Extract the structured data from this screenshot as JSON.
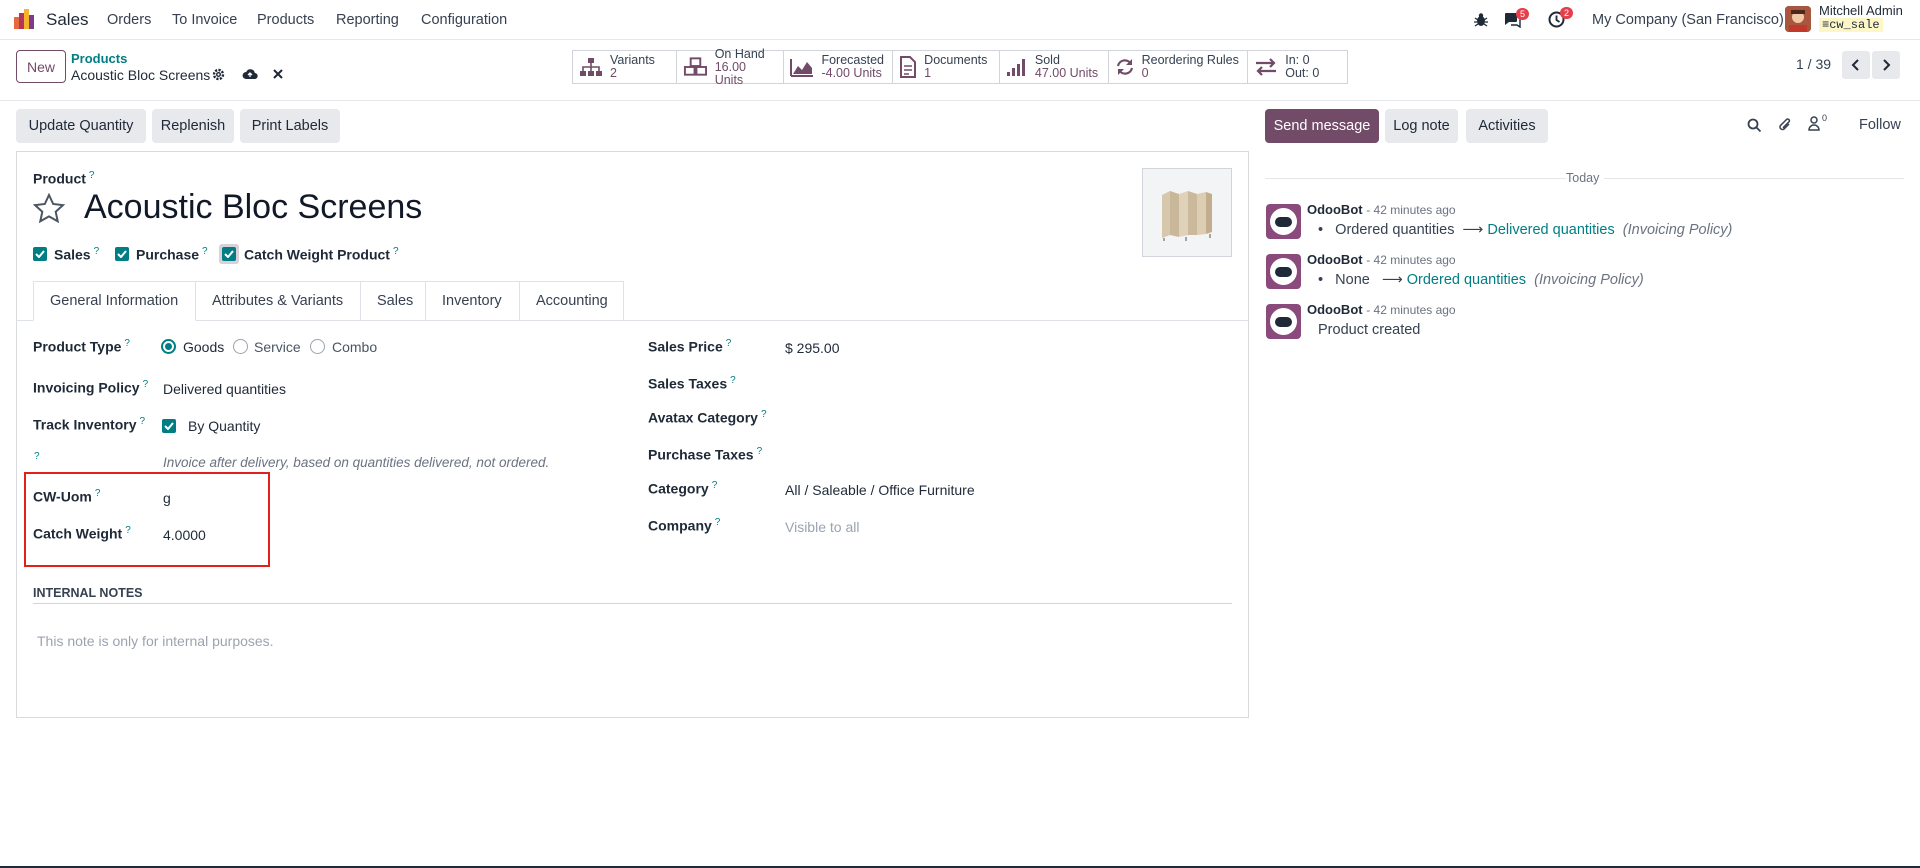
{
  "topnav": {
    "app_name": "Sales",
    "menu": [
      "Orders",
      "To Invoice",
      "Products",
      "Reporting",
      "Configuration"
    ],
    "messages_count": "5",
    "activities_count": "2",
    "company": "My Company (San Francisco)",
    "user_name": "Mitchell Admin",
    "db_name": "cw_sale"
  },
  "breadcrumb": {
    "parent": "Products",
    "current": "Acoustic Bloc Screens"
  },
  "buttons": {
    "new": "New",
    "update_quantity": "Update Quantity",
    "replenish": "Replenish",
    "print_labels": "Print Labels"
  },
  "smart_buttons": {
    "variants": {
      "label": "Variants",
      "value": "2"
    },
    "on_hand": {
      "label": "On Hand",
      "value": "16.00 Units"
    },
    "forecasted": {
      "label": "Forecasted",
      "value": "-4.00 Units"
    },
    "documents": {
      "label": "Documents",
      "value": "1"
    },
    "sold": {
      "label": "Sold",
      "value": "47.00 Units"
    },
    "reordering": {
      "label": "Reordering Rules",
      "value": "0"
    },
    "inout": {
      "in": "In: 0",
      "out": "Out: 0"
    }
  },
  "pager": "1 / 39",
  "form": {
    "product_label": "Product",
    "product_name": "Acoustic Bloc Screens",
    "check_sales": "Sales",
    "check_purchase": "Purchase",
    "check_catch_weight": "Catch Weight Product",
    "tabs": [
      "General Information",
      "Attributes & Variants",
      "Sales",
      "Inventory",
      "Accounting"
    ],
    "product_type_label": "Product Type",
    "product_type_options": [
      "Goods",
      "Service",
      "Combo"
    ],
    "product_type_selected": "Goods",
    "invoicing_policy_label": "Invoicing Policy",
    "invoicing_policy_value": "Delivered quantities",
    "track_inventory_label": "Track Inventory",
    "track_inventory_value": "By Quantity",
    "invoice_hint": "Invoice after delivery, based on quantities delivered, not ordered.",
    "cw_uom_label": "CW-Uom",
    "cw_uom_value": "g",
    "catch_weight_label": "Catch Weight",
    "catch_weight_value": "4.0000",
    "sales_price_label": "Sales Price",
    "sales_price_value": "$ 295.00",
    "sales_taxes_label": "Sales Taxes",
    "avatax_label": "Avatax Category",
    "purchase_taxes_label": "Purchase Taxes",
    "category_label": "Category",
    "category_value": "All / Saleable / Office Furniture",
    "company_label": "Company",
    "company_placeholder": "Visible to all",
    "internal_notes_title": "INTERNAL NOTES",
    "internal_notes_placeholder": "This note is only for internal purposes.",
    "help_mark": "?"
  },
  "chatter": {
    "send_message": "Send message",
    "log_note": "Log note",
    "activities": "Activities",
    "followers_count": "0",
    "follow": "Follow",
    "date_separator": "Today",
    "messages": [
      {
        "author": "OdooBot",
        "time": "- 42 minutes ago",
        "old": "Ordered quantities",
        "new": "Delivered quantities",
        "field": "(Invoicing Policy)"
      },
      {
        "author": "OdooBot",
        "time": "- 42 minutes ago",
        "old": "None",
        "new": "Ordered quantities",
        "field": "(Invoicing Policy)"
      },
      {
        "author": "OdooBot",
        "time": "- 42 minutes ago",
        "body": "Product created"
      }
    ]
  },
  "colors": {
    "brand": "#714b67",
    "accent": "#017e84",
    "highlight": "#e0201d"
  }
}
